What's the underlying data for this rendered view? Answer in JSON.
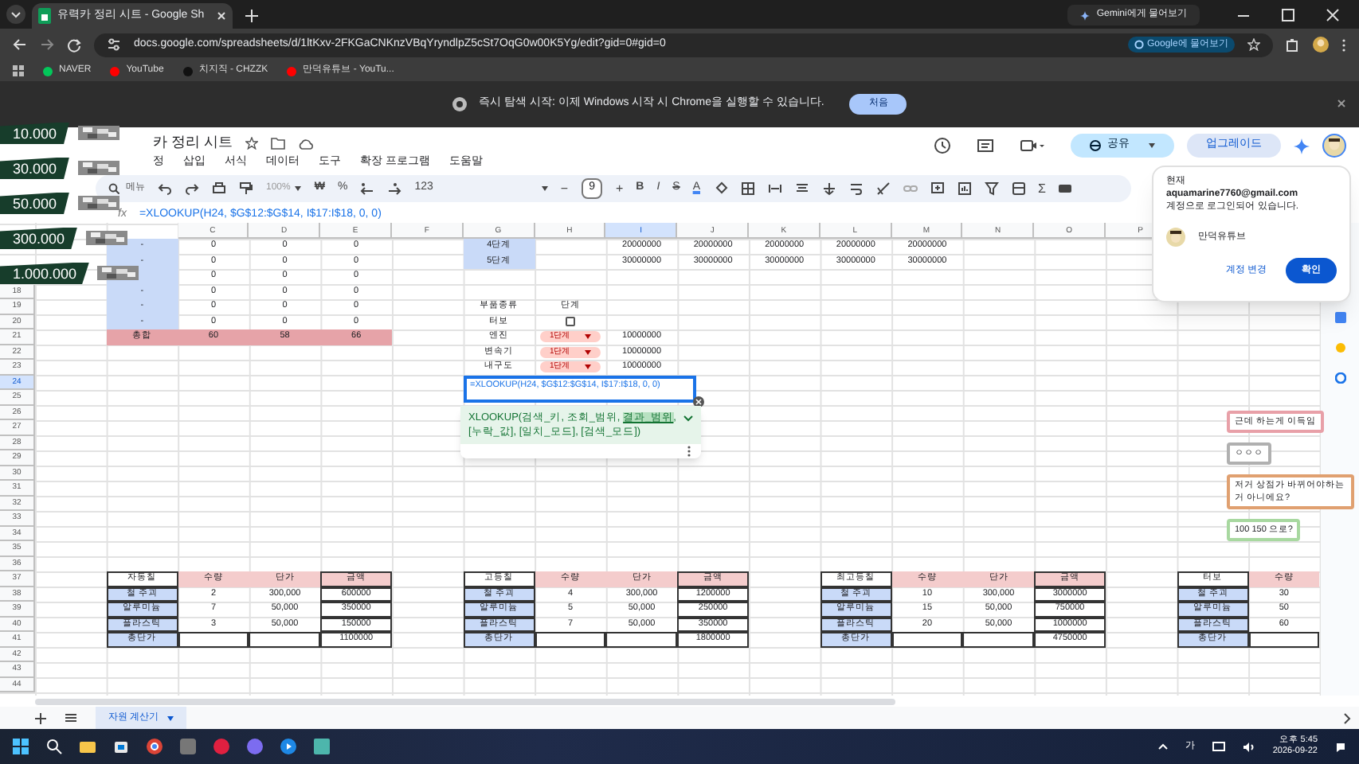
{
  "browser": {
    "tab_title": "유력카 정리 시트 - Google Sh",
    "gemini_button": "Gemini에게 물어보기",
    "url": "docs.google.com/spreadsheets/d/1ltKxv-2FKGaCNKnzVBqYryndlpZ5cSt7OqG0w00K5Yg/edit?gid=0#gid=0",
    "ask_google": "Google에 물어보기",
    "bookmarks": [
      {
        "label": "NAVER",
        "color": "#03c75a"
      },
      {
        "label": "YouTube",
        "color": "#ff0000"
      },
      {
        "label": "치지직 - CHZZK",
        "color": "#111111"
      },
      {
        "label": "만덕유튜브 - YouTu...",
        "color": "#ff0000"
      }
    ],
    "infobar": {
      "message": "즉시 탐색 시작: 이제 Windows 시작 시 Chrome을 실행할 수 있습니다.",
      "button": "처음"
    }
  },
  "sheets": {
    "title": "카 정리 시트",
    "menu": [
      "정",
      "삽입",
      "서식",
      "데이터",
      "도구",
      "확장 프로그램",
      "도움말"
    ],
    "search": "메뉴",
    "zoom": "100%",
    "currency": "₩",
    "percent": "%",
    "number_format": "123",
    "font_minus": "−",
    "font_size": "9",
    "font_plus": "+",
    "styles": [
      "B",
      "I",
      "S",
      "A"
    ],
    "functions": "Σ",
    "share": "공유",
    "upgrade": "업그레이드",
    "fx": "fx",
    "formula": "=XLOOKUP(H24, $G$12:$G$14, I$17:I$18, 0, 0)"
  },
  "account_popup": {
    "line_1": "현재",
    "email": "aquamarine7760@gmail.com",
    "line_2": "계정으로 로그인되어 있습니다.",
    "name": "만덕유튜브",
    "switch": "계정 변경",
    "confirm": "확인"
  },
  "alerts": [
    {
      "amount": "10.000"
    },
    {
      "amount": "30.000"
    },
    {
      "amount": "50.000"
    },
    {
      "amount": "300.000"
    },
    {
      "amount": "1.000.000"
    }
  ],
  "columns": [
    {
      "label": "C",
      "selected": false
    },
    {
      "label": "D",
      "selected": false
    },
    {
      "label": "E",
      "selected": false
    },
    {
      "label": "F",
      "selected": false
    },
    {
      "label": "G",
      "selected": false
    },
    {
      "label": "H",
      "selected": false
    },
    {
      "label": "I",
      "selected": true
    },
    {
      "label": "J",
      "selected": false
    },
    {
      "label": "K",
      "selected": false
    },
    {
      "label": "L",
      "selected": false
    },
    {
      "label": "M",
      "selected": false
    },
    {
      "label": "N",
      "selected": false
    },
    {
      "label": "O",
      "selected": false
    },
    {
      "label": "P",
      "selected": false
    }
  ],
  "rows": [
    {
      "cells": [
        {
          "kind": "blank"
        },
        {
          "kind": "blue",
          "text": "-"
        },
        {
          "kind": "text",
          "text": "0"
        },
        {
          "kind": "text",
          "text": "0"
        },
        {
          "kind": "text",
          "text": "0"
        },
        {
          "kind": "blank"
        },
        {
          "kind": "blue",
          "text": "4단계"
        },
        {
          "kind": "blank"
        },
        {
          "kind": "text",
          "text": "20000000"
        },
        {
          "kind": "text",
          "text": "20000000"
        },
        {
          "kind": "text",
          "text": "20000000"
        },
        {
          "kind": "text",
          "text": "20000000"
        },
        {
          "kind": "text",
          "text": "20000000"
        }
      ]
    },
    {
      "cells": [
        {
          "kind": "blank"
        },
        {
          "kind": "blue",
          "text": "-"
        },
        {
          "kind": "text",
          "text": "0"
        },
        {
          "kind": "text",
          "text": "0"
        },
        {
          "kind": "text",
          "text": "0"
        },
        {
          "kind": "blank"
        },
        {
          "kind": "blue",
          "text": "5단계"
        },
        {
          "kind": "blank"
        },
        {
          "kind": "text",
          "text": "30000000"
        },
        {
          "kind": "text",
          "text": "30000000"
        },
        {
          "kind": "text",
          "text": "30000000"
        },
        {
          "kind": "text",
          "text": "30000000"
        },
        {
          "kind": "text",
          "text": "30000000"
        }
      ]
    },
    {
      "cells": [
        {
          "kind": "blank"
        },
        {
          "kind": "blue"
        },
        {
          "kind": "text",
          "text": "0"
        },
        {
          "kind": "text",
          "text": "0"
        },
        {
          "kind": "text",
          "text": "0"
        }
      ]
    },
    {
      "number": "18",
      "selected": false,
      "cells": [
        {
          "kind": "blank"
        },
        {
          "kind": "blue",
          "text": "-"
        },
        {
          "kind": "text",
          "text": "0"
        },
        {
          "kind": "text",
          "text": "0"
        },
        {
          "kind": "text",
          "text": "0"
        }
      ]
    },
    {
      "number": "19",
      "selected": false,
      "cells": [
        {
          "kind": "blank"
        },
        {
          "kind": "blue",
          "text": "-"
        },
        {
          "kind": "text",
          "text": "0"
        },
        {
          "kind": "text",
          "text": "0"
        },
        {
          "kind": "text",
          "text": "0"
        },
        {
          "kind": "blank"
        },
        {
          "kind": "text",
          "text": "부품종류"
        },
        {
          "kind": "text",
          "text": "단계"
        }
      ]
    },
    {
      "number": "20",
      "selected": false,
      "cells": [
        {
          "kind": "blank"
        },
        {
          "kind": "blue",
          "text": "-"
        },
        {
          "kind": "text",
          "text": "0"
        },
        {
          "kind": "text",
          "text": "0"
        },
        {
          "kind": "text",
          "text": "0"
        },
        {
          "kind": "blank"
        },
        {
          "kind": "text",
          "text": "터보"
        },
        {
          "kind": "checkbox",
          "checked": false
        }
      ]
    },
    {
      "number": "21",
      "selected": false,
      "cells": [
        {
          "kind": "blank"
        },
        {
          "kind": "sum",
          "text": "총합"
        },
        {
          "kind": "sum",
          "text": "60"
        },
        {
          "kind": "sum",
          "text": "58"
        },
        {
          "kind": "sum",
          "text": "66"
        },
        {
          "kind": "blank"
        },
        {
          "kind": "text",
          "text": "엔진"
        },
        {
          "kind": "dropdown",
          "text": "1단계"
        },
        {
          "kind": "text",
          "text": "10000000"
        }
      ]
    },
    {
      "number": "22",
      "selected": false,
      "cells": [
        {
          "kind": "blank"
        },
        {
          "kind": "blank"
        },
        {
          "kind": "blank"
        },
        {
          "kind": "blank"
        },
        {
          "kind": "blank"
        },
        {
          "kind": "blank"
        },
        {
          "kind": "text",
          "text": "변속기"
        },
        {
          "kind": "dropdown",
          "text": "1단계"
        },
        {
          "kind": "text",
          "text": "10000000"
        }
      ]
    },
    {
      "number": "23",
      "selected": false,
      "cells": [
        {
          "kind": "blank"
        },
        {
          "kind": "blank"
        },
        {
          "kind": "blank"
        },
        {
          "kind": "blank"
        },
        {
          "kind": "blank"
        },
        {
          "kind": "blank"
        },
        {
          "kind": "text",
          "text": "내구도"
        },
        {
          "kind": "dropdown",
          "text": "1단계"
        },
        {
          "kind": "text",
          "text": "10000000"
        }
      ]
    },
    {
      "number": "24",
      "selected": true
    },
    {
      "number": "25",
      "selected": false
    },
    {
      "number": "26",
      "selected": false
    },
    {
      "number": "27",
      "selected": false
    },
    {
      "number": "28",
      "selected": false
    },
    {
      "number": "29",
      "selected": false
    },
    {
      "number": "30",
      "selected": false
    },
    {
      "number": "31",
      "selected": false
    },
    {
      "number": "32",
      "selected": false
    },
    {
      "number": "33",
      "selected": false
    },
    {
      "number": "34",
      "selected": false
    },
    {
      "number": "35",
      "selected": false
    },
    {
      "number": "36",
      "selected": false
    },
    {
      "number": "37",
      "selected": false,
      "cells": [
        {
          "kind": "blank"
        },
        {
          "kind": "text",
          "text": "자동칠",
          "boxed": true
        },
        {
          "kind": "pink",
          "text": "수량"
        },
        {
          "kind": "pink",
          "text": "단가"
        },
        {
          "kind": "pink",
          "text": "금액",
          "boxed": true
        },
        {
          "kind": "blank"
        },
        {
          "kind": "text",
          "text": "고등칠",
          "boxed": true
        },
        {
          "kind": "pink",
          "text": "수량"
        },
        {
          "kind": "pink",
          "text": "단가"
        },
        {
          "kind": "pink",
          "text": "금액",
          "boxed": true
        },
        {
          "kind": "blank"
        },
        {
          "kind": "text",
          "text": "최고등칠",
          "boxed": true
        },
        {
          "kind": "pink",
          "text": "수량"
        },
        {
          "kind": "pink",
          "text": "단가"
        },
        {
          "kind": "pink",
          "text": "금액",
          "boxed": true
        },
        {
          "kind": "blank"
        },
        {
          "kind": "text",
          "text": "터보",
          "boxed": true
        },
        {
          "kind": "pink",
          "text": "수량"
        }
      ]
    },
    {
      "number": "38",
      "selected": false,
      "cells": [
        {
          "kind": "blank"
        },
        {
          "kind": "blue",
          "text": "철 주괴",
          "boxed": true
        },
        {
          "kind": "text",
          "text": "2"
        },
        {
          "kind": "text",
          "text": "300,000"
        },
        {
          "kind": "text",
          "text": "600000",
          "boxed": true
        },
        {
          "kind": "blank"
        },
        {
          "kind": "blue",
          "text": "철 주괴",
          "boxed": true
        },
        {
          "kind": "text",
          "text": "4"
        },
        {
          "kind": "text",
          "text": "300,000"
        },
        {
          "kind": "text",
          "text": "1200000",
          "boxed": true
        },
        {
          "kind": "blank"
        },
        {
          "kind": "blue",
          "text": "철 주괴",
          "boxed": true
        },
        {
          "kind": "text",
          "text": "10"
        },
        {
          "kind": "text",
          "text": "300,000"
        },
        {
          "kind": "text",
          "text": "3000000",
          "boxed": true
        },
        {
          "kind": "blank"
        },
        {
          "kind": "blue",
          "text": "철 주괴",
          "boxed": true
        },
        {
          "kind": "text",
          "text": "30"
        }
      ]
    },
    {
      "number": "39",
      "selected": false,
      "cells": [
        {
          "kind": "blank"
        },
        {
          "kind": "blue",
          "text": "알루미늄",
          "boxed": true
        },
        {
          "kind": "text",
          "text": "7"
        },
        {
          "kind": "text",
          "text": "50,000"
        },
        {
          "kind": "text",
          "text": "350000",
          "boxed": true
        },
        {
          "kind": "blank"
        },
        {
          "kind": "blue",
          "text": "알루미늄",
          "boxed": true
        },
        {
          "kind": "text",
          "text": "5"
        },
        {
          "kind": "text",
          "text": "50,000"
        },
        {
          "kind": "text",
          "text": "250000",
          "boxed": true
        },
        {
          "kind": "blank"
        },
        {
          "kind": "blue",
          "text": "알루미늄",
          "boxed": true
        },
        {
          "kind": "text",
          "text": "15"
        },
        {
          "kind": "text",
          "text": "50,000"
        },
        {
          "kind": "text",
          "text": "750000",
          "boxed": true
        },
        {
          "kind": "blank"
        },
        {
          "kind": "blue",
          "text": "알루미늄",
          "boxed": true
        },
        {
          "kind": "text",
          "text": "50"
        }
      ]
    },
    {
      "number": "40",
      "selected": false,
      "cells": [
        {
          "kind": "blank"
        },
        {
          "kind": "blue",
          "text": "플라스틱",
          "boxed": true
        },
        {
          "kind": "text",
          "text": "3"
        },
        {
          "kind": "text",
          "text": "50,000"
        },
        {
          "kind": "text",
          "text": "150000",
          "boxed": true
        },
        {
          "kind": "blank"
        },
        {
          "kind": "blue",
          "text": "플라스틱",
          "boxed": true
        },
        {
          "kind": "text",
          "text": "7"
        },
        {
          "kind": "text",
          "text": "50,000"
        },
        {
          "kind": "text",
          "text": "350000",
          "boxed": true
        },
        {
          "kind": "blank"
        },
        {
          "kind": "blue",
          "text": "플라스틱",
          "boxed": true
        },
        {
          "kind": "text",
          "text": "20"
        },
        {
          "kind": "text",
          "text": "50,000"
        },
        {
          "kind": "text",
          "text": "1000000",
          "boxed": true
        },
        {
          "kind": "blank"
        },
        {
          "kind": "blue",
          "text": "플라스틱",
          "boxed": true
        },
        {
          "kind": "text",
          "text": "60"
        }
      ]
    },
    {
      "number": "41",
      "selected": false,
      "cells": [
        {
          "kind": "blank"
        },
        {
          "kind": "blue",
          "text": "총단가",
          "boxed": true
        },
        {
          "kind": "text",
          "boxed": true
        },
        {
          "kind": "text",
          "boxed": true
        },
        {
          "kind": "text",
          "text": "1100000",
          "boxed": true
        },
        {
          "kind": "blank"
        },
        {
          "kind": "blue",
          "text": "총단가",
          "boxed": true
        },
        {
          "kind": "text",
          "boxed": true
        },
        {
          "kind": "text",
          "boxed": true
        },
        {
          "kind": "text",
          "text": "1800000",
          "boxed": true
        },
        {
          "kind": "blank"
        },
        {
          "kind": "blue",
          "text": "총단가",
          "boxed": true
        },
        {
          "kind": "text",
          "boxed": true
        },
        {
          "kind": "text",
          "boxed": true
        },
        {
          "kind": "text",
          "text": "4750000",
          "boxed": true
        },
        {
          "kind": "blank"
        },
        {
          "kind": "blue",
          "text": "총단가",
          "boxed": true
        },
        {
          "kind": "text",
          "boxed": true
        }
      ]
    },
    {
      "number": "42",
      "selected": false
    },
    {
      "number": "43",
      "selected": false
    },
    {
      "number": "44",
      "selected": false
    }
  ],
  "cell_editor": {
    "formula": "=XLOOKUP(H24, $G$12:$G$14, I$17:I$18, 0, 0)",
    "hint": "XLOOKUP(검색_키, 조회_범위, **결과_범위**, [누락_값], [일치_모드], [검색_모드])"
  },
  "comments": [
    {
      "text": "근데 하는게 이득임",
      "color": "#e8a0a8"
    },
    {
      "text": "ㅇㅇㅇ",
      "color": "#b0b0b0"
    },
    {
      "text": "저거 상점가 바뀌어야하는거 아니에요?",
      "color": "#e0a070"
    },
    {
      "text": "100 150 으로?",
      "color": "#a8d8a0"
    }
  ],
  "sheet_tabs": [
    {
      "label": "자원 계산기",
      "selected": true
    }
  ],
  "taskbar": {
    "ime": "가",
    "time": "오후 5:45",
    "date": "2026-09-22"
  }
}
